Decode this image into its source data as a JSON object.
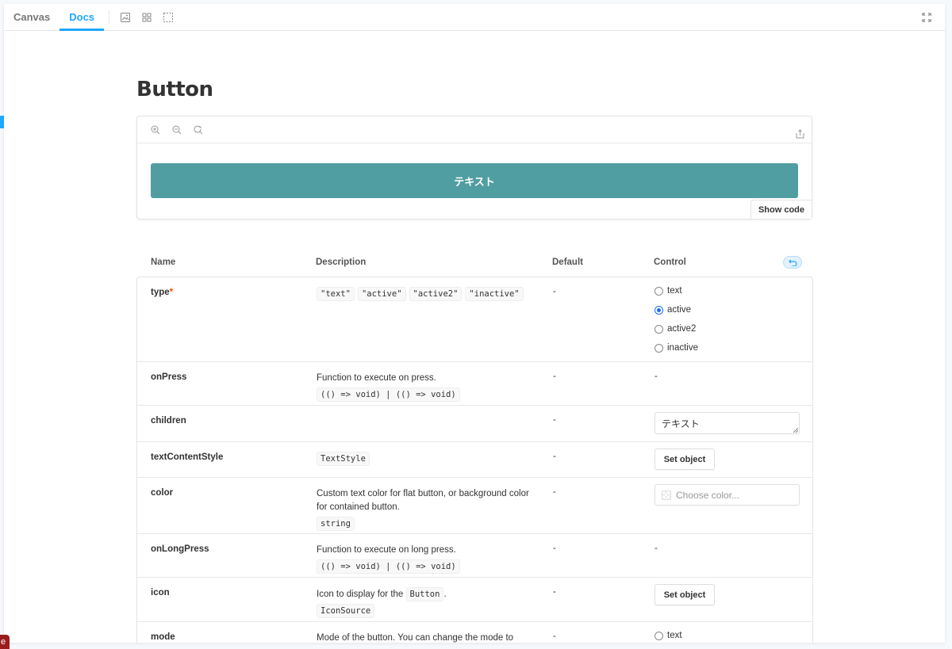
{
  "toolbar": {
    "tabs": [
      {
        "label": "Canvas",
        "active": false
      },
      {
        "label": "Docs",
        "active": true
      }
    ],
    "icons": [
      "image-icon",
      "grid-icon",
      "outline-icon"
    ],
    "fullscreen_icon": "fullscreen-icon"
  },
  "docs": {
    "title": "Button",
    "preview": {
      "button_label": "テキスト",
      "show_code_label": "Show code",
      "button_color": "#519ea2"
    },
    "args_header": {
      "name": "Name",
      "description": "Description",
      "default": "Default",
      "control": "Control"
    },
    "rows": {
      "type": {
        "name": "type",
        "required_mark": "*",
        "codes": [
          "\"text\"",
          "\"active\"",
          "\"active2\"",
          "\"inactive\""
        ],
        "default": "-",
        "options": [
          "text",
          "active",
          "active2",
          "inactive"
        ],
        "selected": "active"
      },
      "onPress": {
        "name": "onPress",
        "desc": "Function to execute on press.",
        "code": "(() => void) | (() => void)",
        "default": "-",
        "control": "-"
      },
      "children": {
        "name": "children",
        "default": "-",
        "value": "テキスト"
      },
      "textContentStyle": {
        "name": "textContentStyle",
        "code": "TextStyle",
        "default": "-",
        "button": "Set object"
      },
      "color": {
        "name": "color",
        "desc": "Custom text color for flat button, or background color for contained button.",
        "code": "string",
        "default": "-",
        "placeholder": "Choose color..."
      },
      "onLongPress": {
        "name": "onLongPress",
        "desc": "Function to execute on long press.",
        "code": "(() => void) | (() => void)",
        "default": "-",
        "control": "-"
      },
      "icon": {
        "name": "icon",
        "desc_prefix": "Icon to display for the",
        "desc_code": "Button",
        "desc_suffix": ".",
        "code": "IconSource",
        "default": "-",
        "button": "Set object"
      },
      "mode": {
        "name": "mode",
        "desc": "Mode of the button. You can change the mode to",
        "default": "-",
        "option": "text"
      }
    }
  },
  "corner_badge": "e"
}
